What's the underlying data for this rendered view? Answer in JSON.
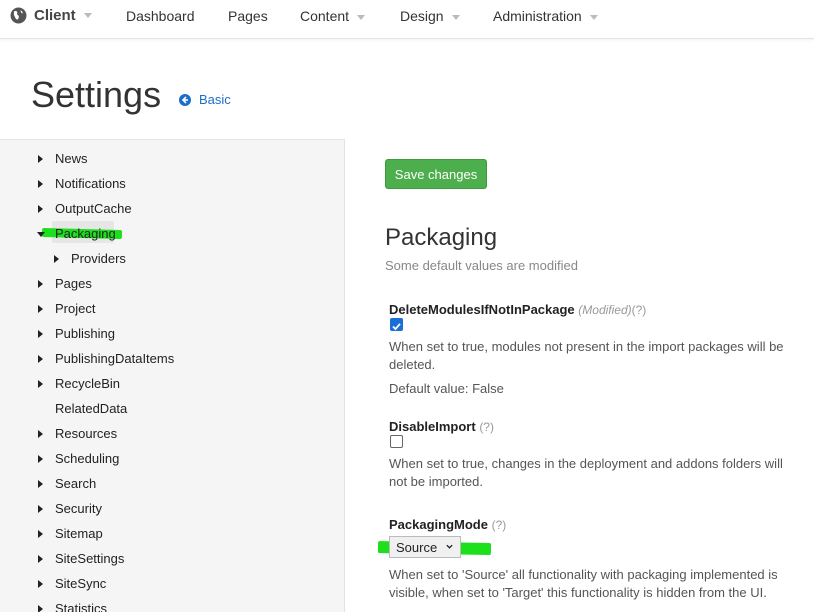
{
  "nav": {
    "brand": "Client",
    "items": [
      "Dashboard",
      "Pages",
      "Content",
      "Design",
      "Administration"
    ]
  },
  "header": {
    "title": "Settings",
    "basic_link": "Basic"
  },
  "sidebar": {
    "items": [
      {
        "label": "News",
        "state": "collapsed"
      },
      {
        "label": "Notifications",
        "state": "collapsed"
      },
      {
        "label": "OutputCache",
        "state": "collapsed"
      },
      {
        "label": "Packaging",
        "state": "expanded",
        "selected": true
      },
      {
        "label": "Providers",
        "state": "collapsed",
        "child": true
      },
      {
        "label": "Pages",
        "state": "collapsed"
      },
      {
        "label": "Project",
        "state": "collapsed"
      },
      {
        "label": "Publishing",
        "state": "collapsed"
      },
      {
        "label": "PublishingDataItems",
        "state": "collapsed"
      },
      {
        "label": "RecycleBin",
        "state": "collapsed"
      },
      {
        "label": "RelatedData",
        "state": "leaf"
      },
      {
        "label": "Resources",
        "state": "collapsed"
      },
      {
        "label": "Scheduling",
        "state": "collapsed"
      },
      {
        "label": "Search",
        "state": "collapsed"
      },
      {
        "label": "Security",
        "state": "collapsed"
      },
      {
        "label": "Sitemap",
        "state": "collapsed"
      },
      {
        "label": "SiteSettings",
        "state": "collapsed"
      },
      {
        "label": "SiteSync",
        "state": "collapsed"
      },
      {
        "label": "Statistics",
        "state": "collapsed"
      }
    ]
  },
  "main": {
    "save_button": "Save changes",
    "section_title": "Packaging",
    "section_subtitle": "Some default values are modified",
    "settings": {
      "delete_modules": {
        "name": "DeleteModulesIfNotInPackage",
        "modified": "(Modified)",
        "help": "(?)",
        "checked": true,
        "description": "When set to true, modules not present in the import packages will be deleted.",
        "default_value": "Default value: False"
      },
      "disable_import": {
        "name": "DisableImport",
        "help": "(?)",
        "checked": false,
        "description": "When set to true, changes in the deployment and addons folders will not be imported."
      },
      "packaging_mode": {
        "name": "PackagingMode",
        "help": "(?)",
        "selected": "Source",
        "description": "When set to 'Source' all functionality with packaging implemented is visible, when set to 'Target' this functionality is hidden from the UI."
      }
    }
  },
  "colors": {
    "accent": "#1a6fc9",
    "save_button": "#4cae4c",
    "checkbox": "#1a6fd6",
    "highlight_marker": "#1be01b"
  }
}
